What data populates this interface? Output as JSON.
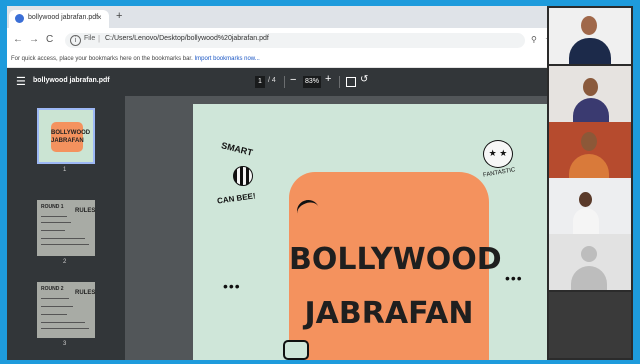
{
  "browser": {
    "tab_title": "bollywood jabrafan.pdf",
    "tab_close": "×",
    "new_tab": "+",
    "back": "←",
    "forward": "→",
    "reload": "C",
    "info": "i",
    "file_label": "File",
    "url_sep": "|",
    "url": "C:/Users/Lenovo/Desktop/bollywood%20jabrafan.pdf",
    "zoom_icon": "⚲",
    "star_icon": "☆",
    "bookmarks_prompt": "For quick access, place your bookmarks here on the bookmarks bar.",
    "bookmarks_link": "Import bookmarks now..."
  },
  "pdf_toolbar": {
    "menu_icon": "☰",
    "title": "bollywood jabrafan.pdf",
    "current_page": "1",
    "page_sep": "/  4",
    "zoom_out": "−",
    "zoom": "83%",
    "zoom_in": "+",
    "rotate_icon": "↺"
  },
  "thumbnails": [
    {
      "label": "1",
      "title_line1": "BOLLYWOOD",
      "title_line2": "JABRAFAN"
    },
    {
      "label": "2",
      "heading": "ROUND 1",
      "rules": "RULES"
    },
    {
      "label": "3",
      "heading": "ROUND 2",
      "rules": "RULES"
    }
  ],
  "page": {
    "title_line1": "BOLLYWOOD",
    "title_line2": "JABRAFAN",
    "sticker_smart": "SMART",
    "sticker_canbee": "CAN BEE!",
    "sticker_fantastic": "FANTASTIC",
    "dots": "•••"
  },
  "colors": {
    "frame_border": "#1e9bdc",
    "toolbar": "#323639",
    "viewer_bg": "#525659",
    "page_bg": "#cfe6d9",
    "card": "#f4925e"
  }
}
